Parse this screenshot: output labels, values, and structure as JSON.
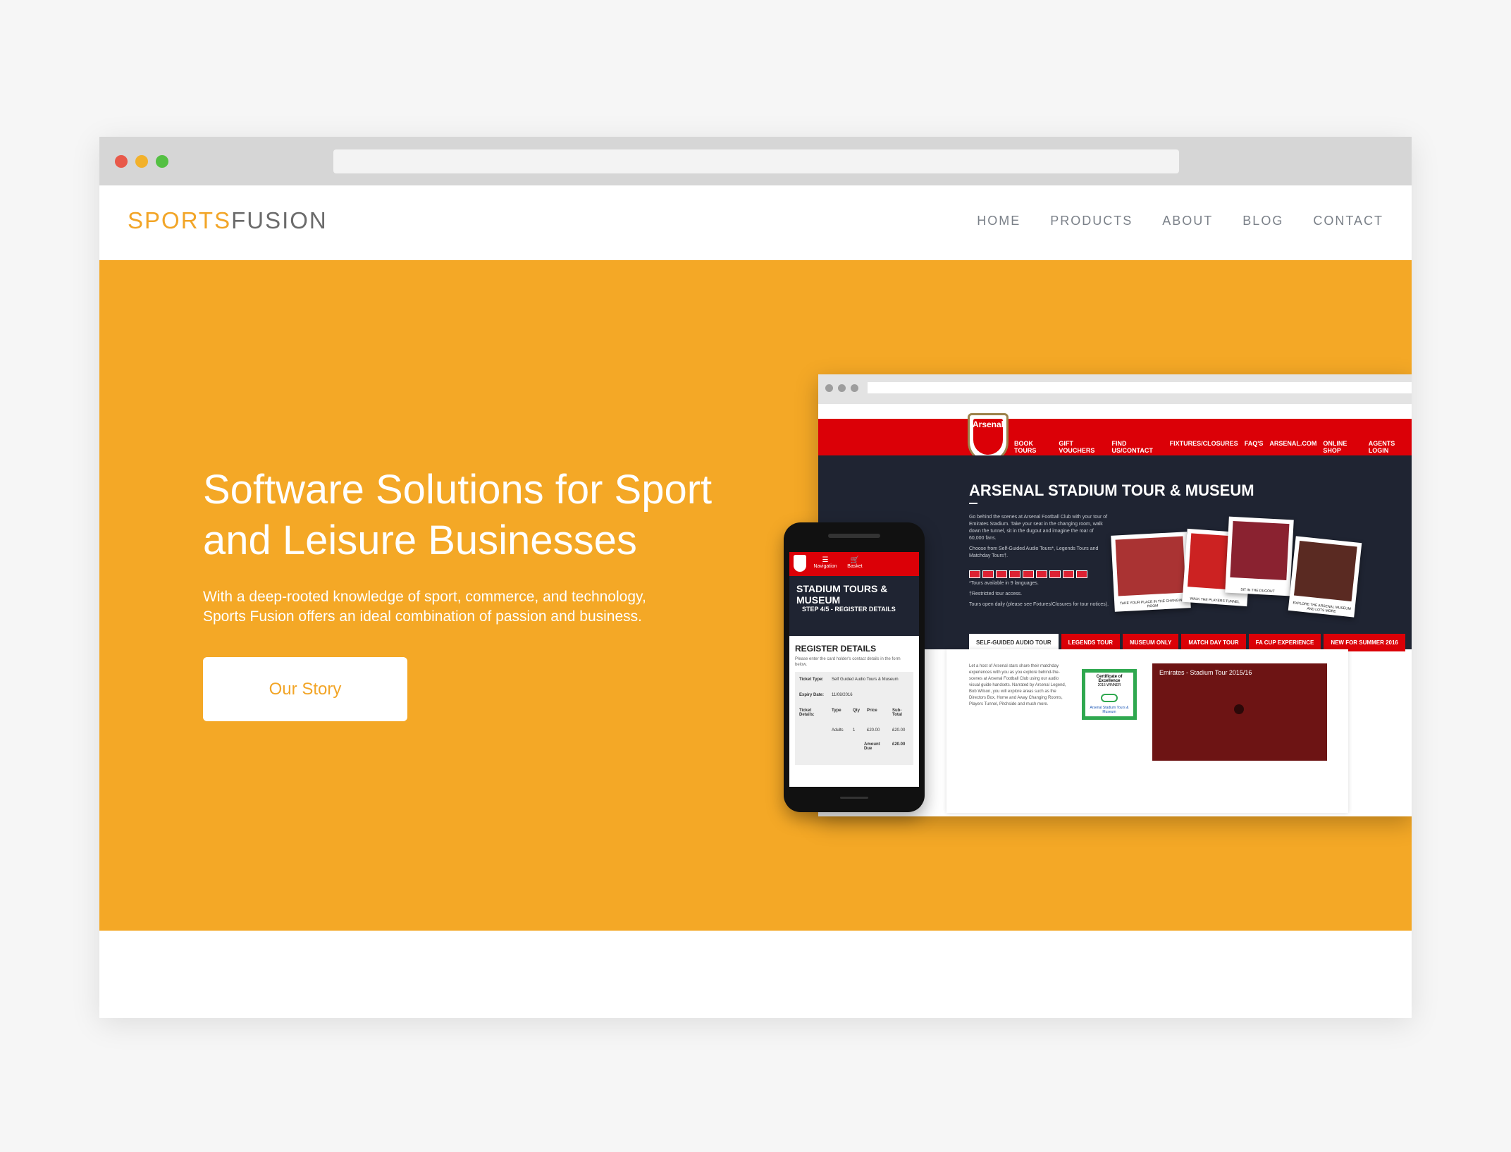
{
  "browser": {
    "dots": [
      "#e8594a",
      "#f2b12b",
      "#54c043"
    ]
  },
  "header": {
    "logo_part1": "SPORTS",
    "logo_part2": "FUSION",
    "nav": [
      "HOME",
      "PRODUCTS",
      "ABOUT",
      "BLOG",
      "CONTACT"
    ]
  },
  "hero": {
    "title_line1": "Software Solutions for Sport",
    "title_line2": "and Leisure Businesses",
    "subtitle_line1": "With a deep-rooted knowledge of sport, commerce, and technology,",
    "subtitle_line2": "Sports Fusion offers an ideal combination of passion and business.",
    "cta": "Our Story",
    "accent": "#f4a826"
  },
  "desktop_mock": {
    "crest": "Arsenal",
    "nav": [
      "BOOK TOURS",
      "GIFT VOUCHERS",
      "FIND US/CONTACT",
      "FIXTURES/CLOSURES",
      "FAQ'S",
      "ARSENAL.COM",
      "ONLINE SHOP",
      "AGENTS LOGIN"
    ],
    "title": "ARSENAL STADIUM TOUR & MUSEUM",
    "intro": "Go behind the scenes at Arsenal Football Club with your tour of Emirates Stadium. Take your seat in the changing room, walk down the tunnel, sit in the dugout and imagine the roar of 60,000 fans.",
    "choose": "Choose from Self-Guided Audio Tours*, Legends Tours and Matchday Tours†.",
    "languages": "*Tours available in 9 languages.",
    "restricted": "†Restricted tour access.",
    "open": "Tours open daily (please see Fixtures/Closures for tour notices).",
    "photo_captions": [
      "TAKE YOUR PLACE IN THE CHANGING ROOM",
      "WALK THE PLAYERS TUNNEL",
      "SIT IN THE DUGOUT",
      "EXPLORE THE ARSENAL MUSEUM AND LOTS MORE"
    ],
    "tabs": [
      "SELF-GUIDED AUDIO TOUR",
      "LEGENDS TOUR",
      "MUSEUM ONLY",
      "MATCH DAY TOUR",
      "FA CUP EXPERIENCE",
      "NEW FOR SUMMER 2016"
    ],
    "body": "Let a host of Arsenal stars share their matchday experiences with you as you explore behind-the-scenes at Arsenal Football Club using our audio visual guide handsets. Narrated by Arsenal Legend, Bob Wilson, you will explore areas such as the Directors Box, Home and Away Changing Rooms, Players Tunnel, Pitchside and much more.",
    "cert_title": "Certificate of Excellence",
    "cert_year": "2015 WINNER",
    "cert_link": "Arsenal Stadium Tours & Museum",
    "video_title": "Emirates - Stadium Tour 2015/16"
  },
  "phone_mock": {
    "nav_label": "Navigation",
    "basket_label": "Basket",
    "title": "STADIUM TOURS & MUSEUM",
    "step": "STEP 4/5 - REGISTER DETAILS",
    "section": "REGISTER DETAILS",
    "help": "Please enter the card holder's contact details in the form below.",
    "ticket_type_label": "Ticket Type:",
    "ticket_type": "Self Guided Audio Tours & Museum",
    "expiry_label": "Expiry Date:",
    "expiry": "11/08/2016",
    "details_label": "Ticket Details:",
    "cols": [
      "Type",
      "Qty",
      "Price",
      "Sub-Total"
    ],
    "row": [
      "Adults",
      "1",
      "£20.00",
      "£20.00"
    ],
    "amount_label": "Amount Due",
    "amount": "£20.00"
  }
}
